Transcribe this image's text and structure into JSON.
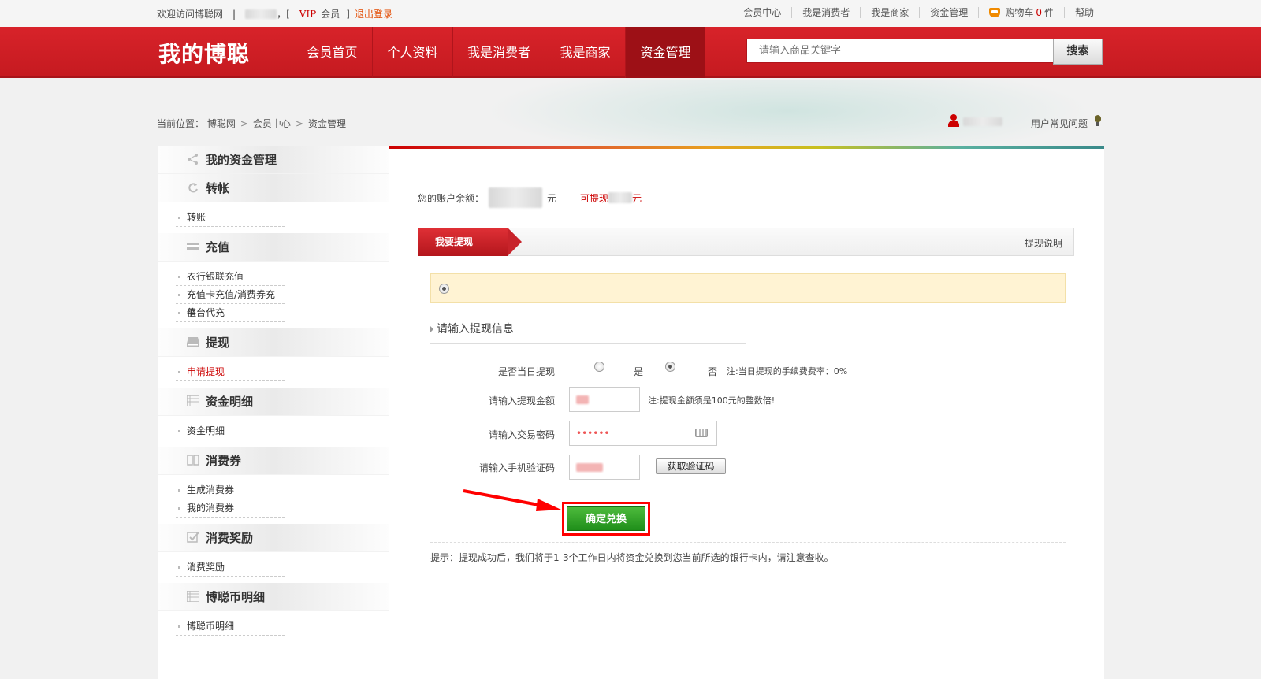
{
  "topbar": {
    "welcome": "欢迎访问博聪网",
    "separator": "|",
    "bracket_open": "，[",
    "vip": "VIP",
    "member": "会员",
    "bracket_close": "]",
    "logout": "退出登录",
    "links": {
      "member_center": "会员中心",
      "consumer": "我是消费者",
      "merchant": "我是商家",
      "funds": "资金管理",
      "cart": "购物车",
      "cart_count": "0",
      "cart_unit": "件",
      "help": "帮助"
    }
  },
  "header": {
    "logo": "我的博聪",
    "nav": [
      "会员首页",
      "个人资料",
      "我是消费者",
      "我是商家",
      "资金管理"
    ],
    "active_nav_index": 4,
    "search_placeholder": "请输入商品关键字",
    "search_button": "搜索"
  },
  "breadcrumb": {
    "label": "当前位置：",
    "items": [
      "博聪网",
      "会员中心",
      "资金管理"
    ],
    "sep": ">"
  },
  "user_bar": {
    "faq": "用户常见问题"
  },
  "sidebar": {
    "title": "我的资金管理",
    "sections": [
      {
        "title": "转帐",
        "icon": "refresh-icon",
        "links": [
          "转账"
        ]
      },
      {
        "title": "充值",
        "icon": "card-icon",
        "links": [
          "农行银联充值",
          "充值卡充值/消费券充值",
          "平台代充"
        ]
      },
      {
        "title": "提现",
        "icon": "drive-icon",
        "links": [
          "申请提现"
        ]
      },
      {
        "title": "资金明细",
        "icon": "ledger-icon",
        "links": [
          "资金明细"
        ]
      },
      {
        "title": "消费券",
        "icon": "book-icon",
        "links": [
          "生成消费券",
          "我的消费券"
        ]
      },
      {
        "title": "消费奖励",
        "icon": "checkbox-icon",
        "links": [
          "消费奖励"
        ]
      },
      {
        "title": "博聪币明细",
        "icon": "ledger-icon",
        "links": [
          "博聪币明细"
        ]
      }
    ],
    "active_link": "申请提现"
  },
  "main": {
    "balance_label": "您的账户余额：",
    "balance_unit": "元",
    "withdrawable_label": "可提现",
    "withdrawable_unit": "元",
    "tab_active": "我要提现",
    "tab_right": "提现说明",
    "form_title": "请输入提现信息",
    "same_day_label": "是否当日提现",
    "yes": "是",
    "no": "否",
    "same_day_note": "注:当日提现的手续费费率：0%",
    "amount_label": "请输入提现金额",
    "amount_note": "注:提现金额须是100元的整数倍!",
    "password_label": "请输入交易密码",
    "password_value": "••••••",
    "sms_label": "请输入手机验证码",
    "get_code_button": "获取验证码",
    "submit_button": "确定兑换",
    "tip": "提示：提现成功后，我们将于1-3个工作日内将资金兑换到您当前所选的银行卡内，请注意查收。"
  },
  "colors": {
    "brand_red": "#d8232a",
    "active_nav": "#9d1016",
    "notice_bg": "#fff3d3",
    "submit_green": "#2a9e22",
    "highlight_red": "#ff0000"
  }
}
